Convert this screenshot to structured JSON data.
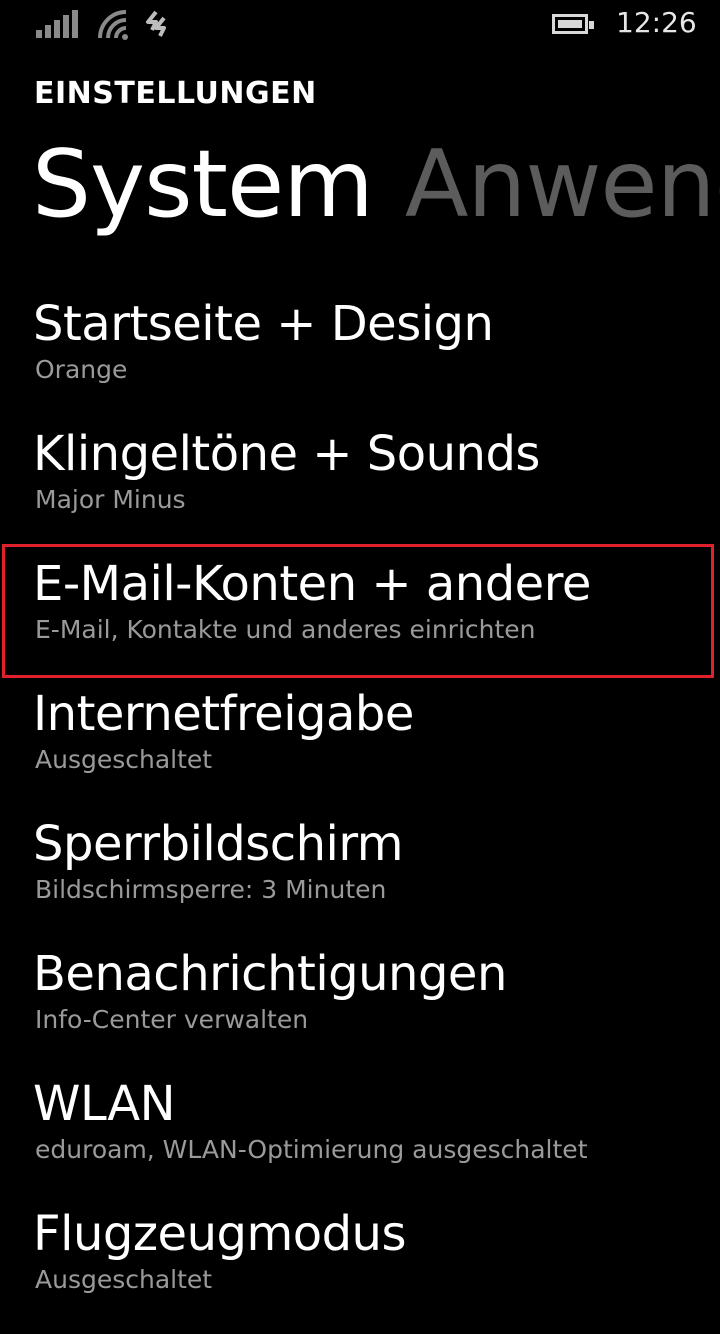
{
  "status_bar": {
    "time": "12:26",
    "icons": [
      "signal-strength-icon",
      "wifi-icon",
      "data-connection-icon",
      "battery-icon"
    ]
  },
  "header": {
    "app_title": "EINSTELLUNGEN"
  },
  "pivot": {
    "tabs": [
      {
        "label": "System",
        "active": true
      },
      {
        "label": "Anwendungen",
        "active": false
      }
    ]
  },
  "settings": {
    "items": [
      {
        "title": "Startseite + Design",
        "subtitle": "Orange"
      },
      {
        "title": "Klingeltöne + Sounds",
        "subtitle": "Major Minus"
      },
      {
        "title": "E-Mail-Konten + andere",
        "subtitle": "E-Mail, Kontakte und anderes einrichten"
      },
      {
        "title": "Internetfreigabe",
        "subtitle": "Ausgeschaltet"
      },
      {
        "title": "Sperrbildschirm",
        "subtitle": "Bildschirmsperre: 3 Minuten"
      },
      {
        "title": "Benachrichtigungen",
        "subtitle": "Info-Center verwalten"
      },
      {
        "title": "WLAN",
        "subtitle": "eduroam, WLAN-Optimierung ausgeschaltet"
      },
      {
        "title": "Flugzeugmodus",
        "subtitle": "Ausgeschaltet"
      }
    ]
  },
  "colors": {
    "background": "#000000",
    "text": "#ffffff",
    "subtitle": "#9a9a9a",
    "inactive_tab": "#5c5c5c",
    "highlight": "#e0202a"
  }
}
